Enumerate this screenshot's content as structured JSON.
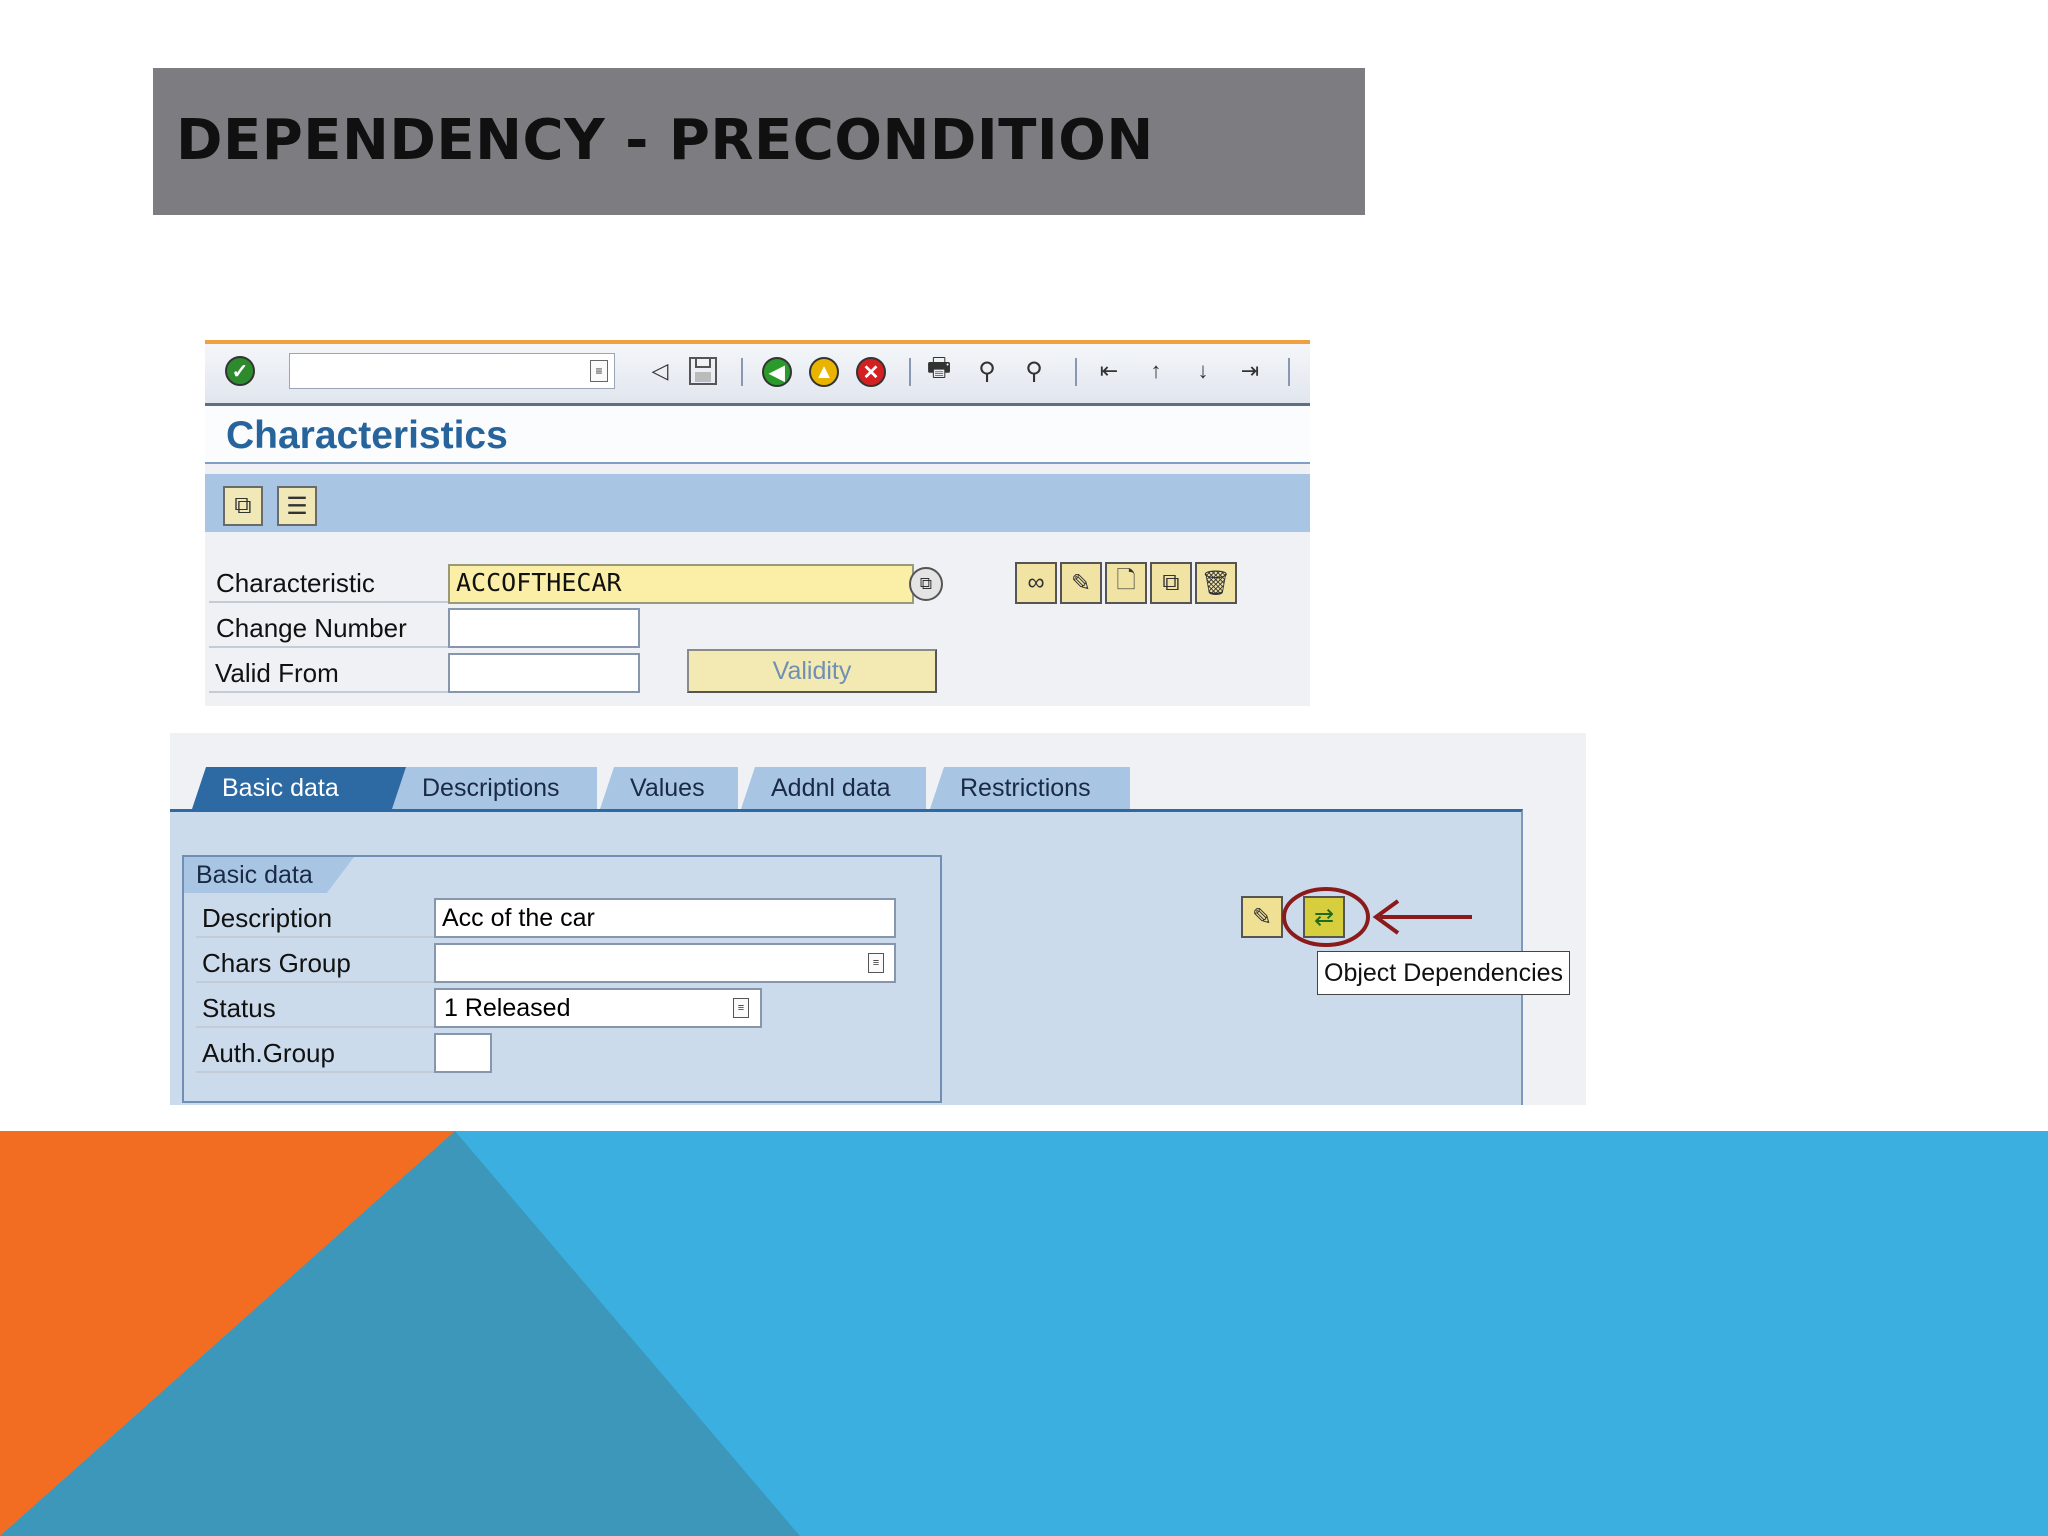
{
  "slide": {
    "title": "DEPENDENCY - PRECONDITION",
    "colors": {
      "title_bar": "#7d7c80",
      "orange": "#f26c22",
      "blue": "#3bb0e0",
      "dark_blue": "#3c97bb"
    }
  },
  "sap_header": {
    "command_field_value": "",
    "toolbar_icons": [
      "enter-icon",
      "dropdown-icon",
      "back-arrow-icon",
      "save-icon",
      "back-icon",
      "exit-icon",
      "cancel-icon",
      "print-icon",
      "find-icon",
      "find-next-icon",
      "first-page-icon",
      "previous-page-icon",
      "next-page-icon",
      "last-page-icon"
    ]
  },
  "screen": {
    "title": "Characteristics",
    "app_toolbar_icons": [
      "other-object-icon",
      "table-icon"
    ]
  },
  "form": {
    "characteristic_label": "Characteristic",
    "characteristic_value": "ACCOFTHECAR",
    "change_number_label": "Change Number",
    "change_number_value": "",
    "valid_from_label": "Valid From",
    "valid_from_value": "",
    "validity_button": "Validity",
    "mode_icons": [
      "display-icon",
      "change-icon",
      "create-icon",
      "copy-icon",
      "delete-icon"
    ]
  },
  "tabs": [
    {
      "label": "Basic data",
      "active": true
    },
    {
      "label": "Descriptions",
      "active": false
    },
    {
      "label": "Values",
      "active": false
    },
    {
      "label": "Addnl data",
      "active": false
    },
    {
      "label": "Restrictions",
      "active": false
    }
  ],
  "basic_data": {
    "group_title": "Basic data",
    "description_label": "Description",
    "description_value": "Acc of the car",
    "chars_group_label": "Chars Group",
    "chars_group_value": "",
    "status_label": "Status",
    "status_value": "1 Released",
    "auth_group_label": "Auth.Group",
    "auth_group_value": ""
  },
  "dependencies": {
    "tooltip": "Object Dependencies",
    "highlight_color": "#8b1a1a"
  }
}
